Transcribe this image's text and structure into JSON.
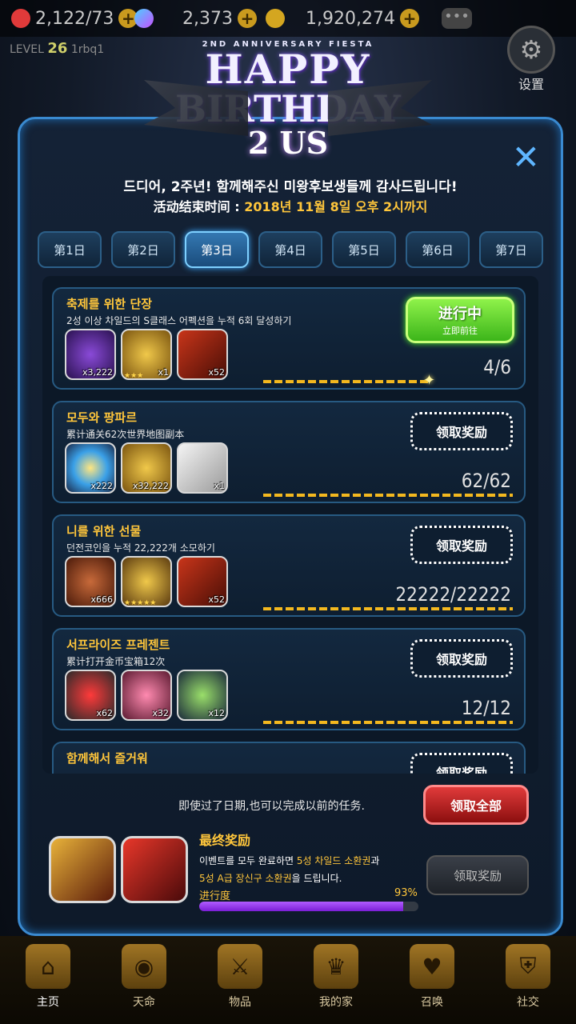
{
  "topbar": {
    "hearts": "2,122/73",
    "gems": "2,373",
    "gold": "1,920,274",
    "level_label": "LEVEL",
    "level_value": "26",
    "username": "1rbq1",
    "settings_label": "设置"
  },
  "banner": {
    "subtitle": "2ND ANNIVERSARY FIESTA",
    "line1": "HAPPY",
    "line2": "BIRTHDAY",
    "line3": "2 US"
  },
  "panel": {
    "message": "드디어, 2주년! 함께해주신 미왕후보생들께 감사드립니다!",
    "end_time_label": "活动结束时间 :",
    "end_time_value": "2018년 11월 8일 오후 2시까지",
    "tabs": [
      "第1日",
      "第2日",
      "第3日",
      "第4日",
      "第5日",
      "第6日",
      "第7日"
    ],
    "active_tab": 2
  },
  "quests": [
    {
      "title": "축제를 위한 단장",
      "desc": "2성 이상 차일드의 S클래스 어펙션을 누적 6회 달성하기",
      "items": [
        {
          "icon": "purple-gem-icon",
          "qty": "x3,222"
        },
        {
          "icon": "gold-coins-icon",
          "qty": "x1",
          "stars": "★★★"
        },
        {
          "icon": "red-ticket-icon",
          "qty": "x52"
        }
      ],
      "progress": "4/6",
      "button_main": "进行中",
      "button_sub": "立即前往"
    },
    {
      "title": "모두와 팡파르",
      "desc": "累计通关62次世界地图副本",
      "items": [
        {
          "icon": "rainbow-crystal-icon",
          "qty": "x222"
        },
        {
          "icon": "gold-pile-icon",
          "qty": "x32,222"
        },
        {
          "icon": "bank-card-icon",
          "qty": "x1"
        }
      ],
      "progress": "62/62",
      "button": "领取奖励"
    },
    {
      "title": "니를 위한 선물",
      "desc": "던전코인을 누적 22,222개 소모하기",
      "items": [
        {
          "icon": "bronze-coin-icon",
          "qty": "x666"
        },
        {
          "icon": "gold-medal-icon",
          "qty": "",
          "stars": "★★★★★"
        },
        {
          "icon": "red-ticket-icon",
          "qty": "x52"
        }
      ],
      "progress": "22222/22222",
      "button": "领取奖励"
    },
    {
      "title": "서프라이즈 프레젠트",
      "desc": "累计打开金币宝箱12次",
      "items": [
        {
          "icon": "heart-icon",
          "qty": "x62"
        },
        {
          "icon": "pink-crystal-icon",
          "qty": "x32"
        },
        {
          "icon": "green-weapon-icon",
          "qty": "x12"
        }
      ],
      "progress": "12/12",
      "button": "领取奖励"
    },
    {
      "title": "함께해서 즐거워",
      "desc": "",
      "items": [],
      "progress": "",
      "button": "领取奖励"
    }
  ],
  "footer": {
    "note": "即使过了日期,也可以完成以前的任务.",
    "claim_all": "领取全部",
    "final_title": "最终奖励",
    "final_desc_1": "이벤트를 모두 완료하면 ",
    "final_desc_hl1": "5성 차일드 소환권",
    "final_desc_2": "과",
    "final_desc_hl2": "5성 A급 장신구 소환권",
    "final_desc_3": "을 드립니다.",
    "progress_label": "进行度",
    "progress_value": "93%",
    "progress_fraction": 0.93,
    "final_claim": "领取奖励"
  },
  "nav": [
    {
      "label": "主页",
      "icon": "castle-icon",
      "glyph": "⌂"
    },
    {
      "label": "天命",
      "icon": "flame-eye-icon",
      "glyph": "◉"
    },
    {
      "label": "物品",
      "icon": "sword-shield-icon",
      "glyph": "⚔"
    },
    {
      "label": "我的家",
      "icon": "crown-wreath-icon",
      "glyph": "♛"
    },
    {
      "label": "召唤",
      "icon": "potion-heart-icon",
      "glyph": "♥"
    },
    {
      "label": "社交",
      "icon": "shield-icon",
      "glyph": "⛨"
    }
  ],
  "colors": {
    "accent_gold": "#ffc63b",
    "panel_border": "#3a8ad0",
    "go_button": "#5fd02a",
    "claim_all": "#c81f1f",
    "progress": "#9a3cf0"
  }
}
